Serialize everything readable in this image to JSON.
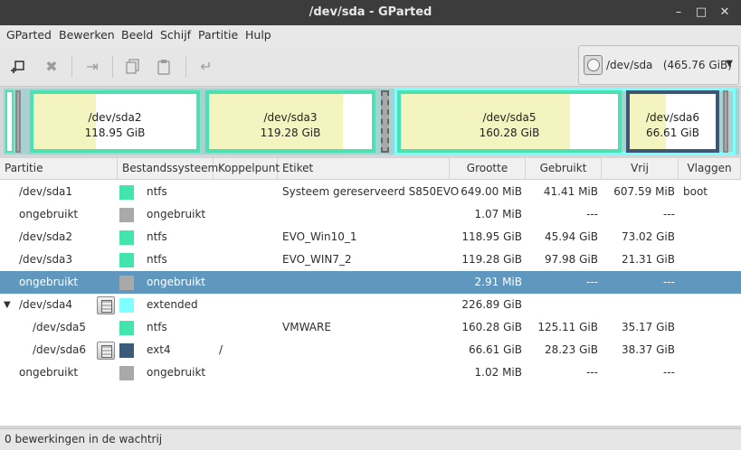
{
  "window": {
    "title": "/dev/sda - GParted",
    "minimize": "–",
    "maximize": "□",
    "close": "✕"
  },
  "menu": [
    "GParted",
    "Bewerken",
    "Beeld",
    "Schijf",
    "Partitie",
    "Hulp"
  ],
  "toolbar": {
    "new_icon": "new-partition-icon",
    "delete_icon": "delete-icon",
    "resize_icon": "resize-move-icon",
    "copy_icon": "copy-icon",
    "paste_icon": "paste-icon",
    "undo_icon": "undo-icon"
  },
  "device_selector": {
    "label": "/dev/sda   (465.76 GiB)",
    "arrow": "▼"
  },
  "diskmap": [
    {
      "name": "/dev/sda2",
      "size": "118.95 GiB",
      "used_fraction": 0.386
    },
    {
      "name": "/dev/sda3",
      "size": "119.28 GiB",
      "used_fraction": 0.821
    },
    {
      "name": "/dev/sda5",
      "size": "160.28 GiB",
      "used_fraction": 0.781
    },
    {
      "name": "/dev/sda6",
      "size": "66.61 GiB",
      "used_fraction": 0.424
    }
  ],
  "table": {
    "headers": [
      "Partitie",
      "Bestandssysteem",
      "Koppelpunt",
      "Etiket",
      "Grootte",
      "Gebruikt",
      "Vrij",
      "Vlaggen"
    ],
    "rows": [
      {
        "partition": "/dev/sda1",
        "fs": "ntfs",
        "fs_color": "#42e5ac",
        "mount": "",
        "label": "Systeem gereserveerd S850EVO",
        "size": "649.00 MiB",
        "used": "41.41 MiB",
        "free": "607.59 MiB",
        "flags": "boot",
        "indent": 1,
        "locked": false,
        "selected": false,
        "expander": ""
      },
      {
        "partition": "ongebruikt",
        "fs": "ongebruikt",
        "fs_color": "#a9a9a9",
        "mount": "",
        "label": "",
        "size": "1.07 MiB",
        "used": "---",
        "free": "---",
        "flags": "",
        "indent": 1,
        "locked": false,
        "selected": false,
        "expander": ""
      },
      {
        "partition": "/dev/sda2",
        "fs": "ntfs",
        "fs_color": "#42e5ac",
        "mount": "",
        "label": "EVO_Win10_1",
        "size": "118.95 GiB",
        "used": "45.94 GiB",
        "free": "73.02 GiB",
        "flags": "",
        "indent": 1,
        "locked": false,
        "selected": false,
        "expander": ""
      },
      {
        "partition": "/dev/sda3",
        "fs": "ntfs",
        "fs_color": "#42e5ac",
        "mount": "",
        "label": "EVO_WIN7_2",
        "size": "119.28 GiB",
        "used": "97.98 GiB",
        "free": "21.31 GiB",
        "flags": "",
        "indent": 1,
        "locked": false,
        "selected": false,
        "expander": ""
      },
      {
        "partition": "ongebruikt",
        "fs": "ongebruikt",
        "fs_color": "#a9a9a9",
        "mount": "",
        "label": "",
        "size": "2.91 MiB",
        "used": "---",
        "free": "---",
        "flags": "",
        "indent": 1,
        "locked": false,
        "selected": true,
        "expander": ""
      },
      {
        "partition": "/dev/sda4",
        "fs": "extended",
        "fs_color": "#7fffff",
        "mount": "",
        "label": "",
        "size": "226.89 GiB",
        "used": "",
        "free": "",
        "flags": "",
        "indent": 1,
        "locked": true,
        "selected": false,
        "expander": "▼"
      },
      {
        "partition": "/dev/sda5",
        "fs": "ntfs",
        "fs_color": "#42e5ac",
        "mount": "",
        "label": "VMWARE",
        "size": "160.28 GiB",
        "used": "125.11 GiB",
        "free": "35.17 GiB",
        "flags": "",
        "indent": 2,
        "locked": false,
        "selected": false,
        "expander": ""
      },
      {
        "partition": "/dev/sda6",
        "fs": "ext4",
        "fs_color": "#3b5b78",
        "mount": "/",
        "label": "",
        "size": "66.61 GiB",
        "used": "28.23 GiB",
        "free": "38.37 GiB",
        "flags": "",
        "indent": 2,
        "locked": true,
        "selected": false,
        "expander": ""
      },
      {
        "partition": "ongebruikt",
        "fs": "ongebruikt",
        "fs_color": "#a9a9a9",
        "mount": "",
        "label": "",
        "size": "1.02 MiB",
        "used": "---",
        "free": "---",
        "flags": "",
        "indent": 1,
        "locked": false,
        "selected": false,
        "expander": ""
      }
    ]
  },
  "status": "0 bewerkingen in de wachtrij"
}
